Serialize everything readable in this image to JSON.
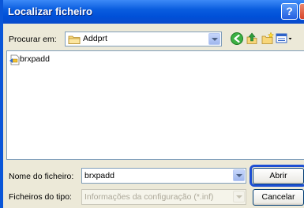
{
  "window": {
    "title": "Localizar ficheiro"
  },
  "lookin": {
    "label": "Procurar em:",
    "value": "Addprt"
  },
  "toolbar": {
    "icons": [
      "back-icon",
      "up-folder-icon",
      "new-folder-icon",
      "view-menu-icon"
    ]
  },
  "files": [
    {
      "name": "brxpadd",
      "icon": "setup-info-icon"
    }
  ],
  "filename": {
    "label": "Nome do ficheiro:",
    "value": "brxpadd"
  },
  "filetype": {
    "label": "Ficheiros do tipo:",
    "value": "Informações da configuração (*.inf)"
  },
  "buttons": {
    "open": "Abrir",
    "cancel": "Cancelar",
    "help": "?"
  },
  "colors": {
    "titlebar": "#0a5ddf",
    "highlight": "#1d4fd3"
  }
}
